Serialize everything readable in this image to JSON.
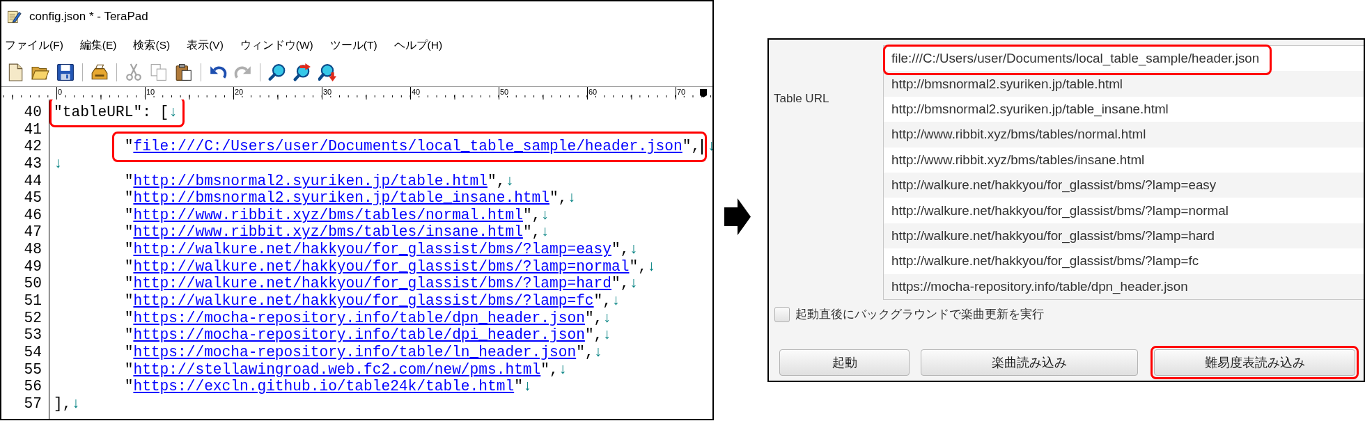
{
  "editor_window": {
    "title": "config.json * - TeraPad",
    "menu": [
      "ファイル(F)",
      "編集(E)",
      "検索(S)",
      "表示(V)",
      "ウィンドウ(W)",
      "ツール(T)",
      "ヘルプ(H)"
    ],
    "toolbar": [
      {
        "buttons": [
          {
            "disabled": false
          },
          {
            "disabled": false
          },
          {
            "disabled": false
          }
        ]
      },
      {
        "buttons": [
          {
            "disabled": false
          }
        ]
      },
      {
        "buttons": [
          {
            "disabled": true
          },
          {
            "disabled": true
          },
          {
            "disabled": false
          }
        ]
      },
      {
        "buttons": [
          {
            "disabled": false
          },
          {
            "disabled": true
          }
        ]
      },
      {
        "buttons": [
          {
            "disabled": false
          },
          {
            "disabled": false
          },
          {
            "disabled": false
          }
        ]
      }
    ],
    "ruler": [
      "0",
      "10",
      "20",
      "30",
      "40",
      "50",
      "60",
      "70"
    ],
    "lines": [
      {
        "number": "40",
        "indented": false,
        "framed": [
          {
            "kind": "text",
            "text": "\"tableURL\": ["
          },
          {
            "kind": "eol",
            "text": "↓"
          }
        ]
      },
      {
        "number": "41"
      },
      {
        "number": "42",
        "indented": true,
        "framed": [
          {
            "kind": "text",
            "text": "\""
          },
          {
            "kind": "link",
            "text": "file:///C:/Users/user/Documents/local_table_sample/header.json"
          },
          {
            "kind": "text",
            "text": "\","
          },
          {
            "kind": "caret"
          }
        ],
        "segments": [
          {
            "kind": "eol",
            "text": "↓"
          }
        ]
      },
      {
        "number": "43",
        "indented": false,
        "segments": [
          {
            "kind": "eol",
            "text": "↓"
          }
        ]
      },
      {
        "number": "44",
        "indented": true,
        "segments": [
          {
            "kind": "text",
            "text": "\""
          },
          {
            "kind": "link",
            "text": "http://bmsnormal2.syuriken.jp/table.html"
          },
          {
            "kind": "text",
            "text": "\","
          },
          {
            "kind": "eol",
            "text": "↓"
          }
        ]
      },
      {
        "number": "45",
        "indented": true,
        "segments": [
          {
            "kind": "text",
            "text": "\""
          },
          {
            "kind": "link",
            "text": "http://bmsnormal2.syuriken.jp/table_insane.html"
          },
          {
            "kind": "text",
            "text": "\","
          },
          {
            "kind": "eol",
            "text": "↓"
          }
        ]
      },
      {
        "number": "46",
        "indented": true,
        "segments": [
          {
            "kind": "text",
            "text": "\""
          },
          {
            "kind": "link",
            "text": "http://www.ribbit.xyz/bms/tables/normal.html"
          },
          {
            "kind": "text",
            "text": "\","
          },
          {
            "kind": "eol",
            "text": "↓"
          }
        ]
      },
      {
        "number": "47",
        "indented": true,
        "segments": [
          {
            "kind": "text",
            "text": "\""
          },
          {
            "kind": "link",
            "text": "http://www.ribbit.xyz/bms/tables/insane.html"
          },
          {
            "kind": "text",
            "text": "\","
          },
          {
            "kind": "eol",
            "text": "↓"
          }
        ]
      },
      {
        "number": "48",
        "indented": true,
        "segments": [
          {
            "kind": "text",
            "text": "\""
          },
          {
            "kind": "link",
            "text": "http://walkure.net/hakkyou/for_glassist/bms/?lamp=easy"
          },
          {
            "kind": "text",
            "text": "\","
          },
          {
            "kind": "eol",
            "text": "↓"
          }
        ]
      },
      {
        "number": "49",
        "indented": true,
        "segments": [
          {
            "kind": "text",
            "text": "\""
          },
          {
            "kind": "link",
            "text": "http://walkure.net/hakkyou/for_glassist/bms/?lamp=normal"
          },
          {
            "kind": "text",
            "text": "\","
          },
          {
            "kind": "eol",
            "text": "↓"
          }
        ]
      },
      {
        "number": "50",
        "indented": true,
        "segments": [
          {
            "kind": "text",
            "text": "\""
          },
          {
            "kind": "link",
            "text": "http://walkure.net/hakkyou/for_glassist/bms/?lamp=hard"
          },
          {
            "kind": "text",
            "text": "\","
          },
          {
            "kind": "eol",
            "text": "↓"
          }
        ]
      },
      {
        "number": "51",
        "indented": true,
        "segments": [
          {
            "kind": "text",
            "text": "\""
          },
          {
            "kind": "link",
            "text": "http://walkure.net/hakkyou/for_glassist/bms/?lamp=fc"
          },
          {
            "kind": "text",
            "text": "\","
          },
          {
            "kind": "eol",
            "text": "↓"
          }
        ]
      },
      {
        "number": "52",
        "indented": true,
        "segments": [
          {
            "kind": "text",
            "text": "\""
          },
          {
            "kind": "link",
            "text": "https://mocha-repository.info/table/dpn_header.json"
          },
          {
            "kind": "text",
            "text": "\","
          },
          {
            "kind": "eol",
            "text": "↓"
          }
        ]
      },
      {
        "number": "53",
        "indented": true,
        "segments": [
          {
            "kind": "text",
            "text": "\""
          },
          {
            "kind": "link",
            "text": "https://mocha-repository.info/table/dpi_header.json"
          },
          {
            "kind": "text",
            "text": "\","
          },
          {
            "kind": "eol",
            "text": "↓"
          }
        ]
      },
      {
        "number": "54",
        "indented": true,
        "segments": [
          {
            "kind": "text",
            "text": "\""
          },
          {
            "kind": "link",
            "text": "https://mocha-repository.info/table/ln_header.json"
          },
          {
            "kind": "text",
            "text": "\","
          },
          {
            "kind": "eol",
            "text": "↓"
          }
        ]
      },
      {
        "number": "55",
        "indented": true,
        "segments": [
          {
            "kind": "text",
            "text": "\""
          },
          {
            "kind": "link",
            "text": "http://stellawingroad.web.fc2.com/new/pms.html"
          },
          {
            "kind": "text",
            "text": "\","
          },
          {
            "kind": "eol",
            "text": "↓"
          }
        ]
      },
      {
        "number": "56",
        "indented": true,
        "segments": [
          {
            "kind": "text",
            "text": "\""
          },
          {
            "kind": "link",
            "text": "https://excln.github.io/table24k/table.html"
          },
          {
            "kind": "text",
            "text": "\""
          },
          {
            "kind": "eol",
            "text": "↓"
          }
        ]
      },
      {
        "number": "57",
        "indented": false,
        "segments": [
          {
            "kind": "text",
            "text": "],"
          },
          {
            "kind": "eol",
            "text": "↓"
          }
        ]
      }
    ]
  },
  "launcher": {
    "table_url": {
      "label": "Table URL",
      "rows": [
        {
          "url": "file:///C:/Users/user/Documents/local_table_sample/header.json",
          "highlighted": true
        },
        {
          "url": "http://bmsnormal2.syuriken.jp/table.html",
          "highlighted": false
        },
        {
          "url": "http://bmsnormal2.syuriken.jp/table_insane.html",
          "highlighted": false
        },
        {
          "url": "http://www.ribbit.xyz/bms/tables/normal.html",
          "highlighted": false
        },
        {
          "url": "http://www.ribbit.xyz/bms/tables/insane.html",
          "highlighted": false
        },
        {
          "url": "http://walkure.net/hakkyou/for_glassist/bms/?lamp=easy",
          "highlighted": false
        },
        {
          "url": "http://walkure.net/hakkyou/for_glassist/bms/?lamp=normal",
          "highlighted": false
        },
        {
          "url": "http://walkure.net/hakkyou/for_glassist/bms/?lamp=hard",
          "highlighted": false
        },
        {
          "url": "http://walkure.net/hakkyou/for_glassist/bms/?lamp=fc",
          "highlighted": false
        },
        {
          "url": "https://mocha-repository.info/table/dpn_header.json",
          "highlighted": false
        }
      ]
    },
    "background_update": {
      "label": "起動直後にバックグラウンドで楽曲更新を実行",
      "checked": false
    },
    "buttons": [
      {
        "label": "起動",
        "highlighted": false
      },
      {
        "label": "楽曲読み込み",
        "highlighted": false
      },
      {
        "label": "難易度表読み込み",
        "highlighted": true
      }
    ]
  }
}
